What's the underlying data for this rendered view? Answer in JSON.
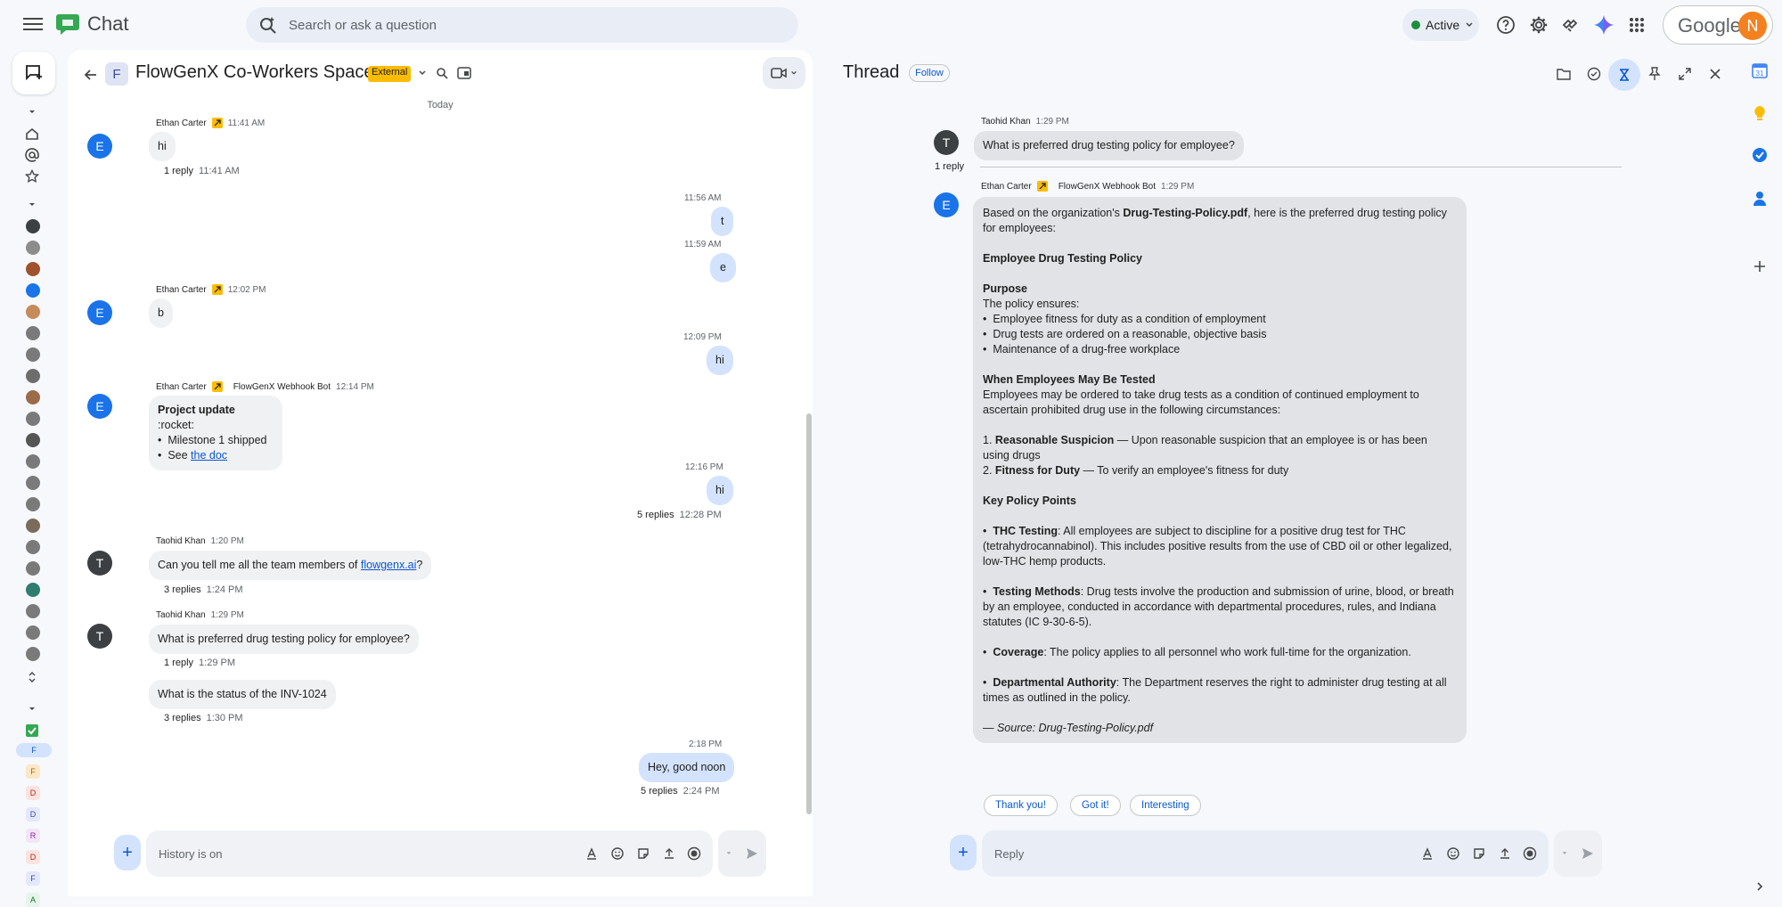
{
  "app": {
    "title": "Chat"
  },
  "search": {
    "placeholder": "Search or ask a question"
  },
  "status": {
    "label": "Active",
    "color": "#1e8e3e"
  },
  "account": {
    "brand": "Google",
    "initial": "N",
    "avatar_color": "#f4811f"
  },
  "icons": {
    "top": [
      "help-icon",
      "settings-icon",
      "apps-script-icon",
      "gemini-icon",
      "apps-grid-icon"
    ],
    "side": [
      "calendar-icon",
      "keep-icon",
      "tasks-icon",
      "contacts-icon",
      "add-icon",
      "expand-icon"
    ]
  },
  "rail": {
    "letters": [
      "F",
      "F",
      "D",
      "D",
      "R",
      "D",
      "F",
      "A"
    ]
  },
  "space": {
    "avatar_letter": "F",
    "title": "FlowGenX Co-Workers Space",
    "badge": "External",
    "day_separator": "Today"
  },
  "messages": {
    "m1": {
      "sender": "Ethan Carter",
      "time": "11:41 AM",
      "text": "hi",
      "reply_count": "1 reply",
      "reply_time": "11:41 AM",
      "avatar": "E"
    },
    "own1": {
      "time": "11:56 AM",
      "text": "t"
    },
    "own2": {
      "time": "11:59 AM",
      "text": "e"
    },
    "m2": {
      "sender": "Ethan Carter",
      "time": "12:02 PM",
      "text": "b",
      "avatar": "E"
    },
    "own3": {
      "time": "12:09 PM",
      "text": "hi"
    },
    "m3": {
      "sender": "Ethan Carter",
      "via": "FlowGenX Webhook Bot",
      "time": "12:14 PM",
      "avatar": "E",
      "title": "Project update",
      "title_suffix": " :rocket:",
      "bullet1": "Milestone 1 shipped",
      "bullet2_prefix": "See ",
      "bullet2_link": "the doc"
    },
    "own4": {
      "time": "12:16 PM",
      "text": "hi",
      "reply_count": "5 replies",
      "reply_time": "12:28 PM"
    },
    "m4": {
      "sender": "Taohid Khan",
      "time": "1:20 PM",
      "avatar": "T",
      "text_prefix": "Can you tell me all the team members of ",
      "link": "flowgenx.ai",
      "text_suffix": "?",
      "reply_count": "3 replies",
      "reply_time": "1:24 PM"
    },
    "m5": {
      "sender": "Taohid Khan",
      "time": "1:29 PM",
      "avatar": "T",
      "text": "What is preferred drug testing policy for employee?",
      "reply_count": "1 reply",
      "reply_time": "1:29 PM"
    },
    "m6": {
      "text": "What is the status of the INV-1024",
      "reply_count": "3 replies",
      "reply_time": "1:30 PM"
    },
    "own5": {
      "time": "2:18 PM",
      "text": "Hey, good noon",
      "reply_count": "5 replies",
      "reply_time": "2:24 PM"
    }
  },
  "composer": {
    "placeholder": "History is on"
  },
  "thread": {
    "title": "Thread",
    "follow": "Follow",
    "root": {
      "sender": "Taohid Khan",
      "time": "1:29 PM",
      "avatar": "T",
      "text": "What is preferred drug testing policy for employee?"
    },
    "reply_count": "1 reply",
    "reply": {
      "sender": "Ethan Carter",
      "via": "FlowGenX Webhook Bot",
      "time": "1:29 PM",
      "avatar": "E",
      "intro_prefix": "Based on the organization's ",
      "intro_file": "Drug-Testing-Policy.pdf",
      "intro_suffix": ", here is the preferred drug testing policy for employees:",
      "heading": "Employee Drug Testing Policy",
      "purpose_title": "Purpose",
      "purpose_intro": "The policy ensures:",
      "purpose_items": [
        "Employee fitness for duty as a condition of employment",
        "Drug tests are ordered on a reasonable, objective basis",
        "Maintenance of a drug-free workplace"
      ],
      "when_title": "When Employees May Be Tested",
      "when_text": "Employees may be ordered to take drug tests as a condition of continued employment to ascertain prohibited drug use in the following circumstances:",
      "when_1_num": "1. ",
      "when_1_title": "Reasonable Suspicion",
      "when_1_text": " — Upon reasonable suspicion that an employee is or has been using drugs",
      "when_2_num": "2. ",
      "when_2_title": "Fitness for Duty",
      "when_2_text": " — To verify an employee's fitness for duty",
      "key_title": "Key Policy Points",
      "thc_title": "THC Testing",
      "thc_text": ": All employees are subject to discipline for a positive drug test for THC (tetrahydrocannabinol). This includes positive results from the use of CBD oil or other legalized, low-THC hemp products.",
      "methods_title": "Testing Methods",
      "methods_text": ": Drug tests involve the production and submission of urine, blood, or breath by an employee, conducted in accordance with departmental procedures, rules, and Indiana statutes (IC 9-30-6-5).",
      "coverage_title": "Coverage",
      "coverage_text": ": The policy applies to all personnel who work full-time for the organization.",
      "authority_title": "Departmental Authority",
      "authority_text": ": The Department reserves the right to administer drug testing at all times as outlined in the policy.",
      "source": "— Source: Drug-Testing-Policy.pdf"
    },
    "chips": [
      "Thank you!",
      "Got it!",
      "Interesting"
    ],
    "composer_placeholder": "Reply"
  }
}
